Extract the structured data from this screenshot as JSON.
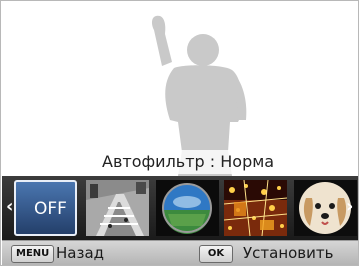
{
  "preview": {
    "filter_caption": "Автофильтр : Норма"
  },
  "filter_strip": {
    "selected_label": "OFF",
    "items": [
      {
        "name": "off"
      },
      {
        "name": "miniature"
      },
      {
        "name": "fisheye"
      },
      {
        "name": "sketch"
      },
      {
        "name": "vignette"
      }
    ]
  },
  "bottom_bar": {
    "menu_key": "MENU",
    "back_label": "Назад",
    "ok_key": "OK",
    "set_label": "Установить"
  },
  "colors": {
    "selected_frame": "#4a76b0",
    "strip_bg": "#2a2a2a",
    "bottom_bar_bg": "#c4c4c4",
    "silhouette": "#c9c9c9"
  }
}
